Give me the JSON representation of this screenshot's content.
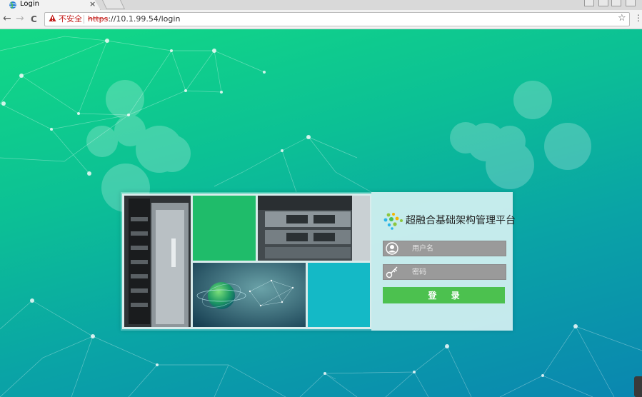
{
  "browser": {
    "tab_title": "Login",
    "tab_close": "×",
    "security_label": "不安全",
    "url_scheme": "https",
    "url_rest": "://10.1.99.54/login",
    "back": "←",
    "forward": "→",
    "reload": "C",
    "star": "☆",
    "menu": "⋮"
  },
  "login": {
    "title": "超融合基础架构管理平台",
    "username_placeholder": "用户名",
    "password_placeholder": "密码",
    "submit_label": "登 录"
  },
  "icons": {
    "favicon": "globe-icon",
    "security": "warning-icon",
    "username": "user-icon",
    "password": "key-icon",
    "logo": "dots-logo-icon"
  },
  "colors": {
    "button": "#4cc14f",
    "insecure": "#c5221f",
    "tile_green": "#1fbc6a",
    "tile_teal": "#14b9c6"
  }
}
